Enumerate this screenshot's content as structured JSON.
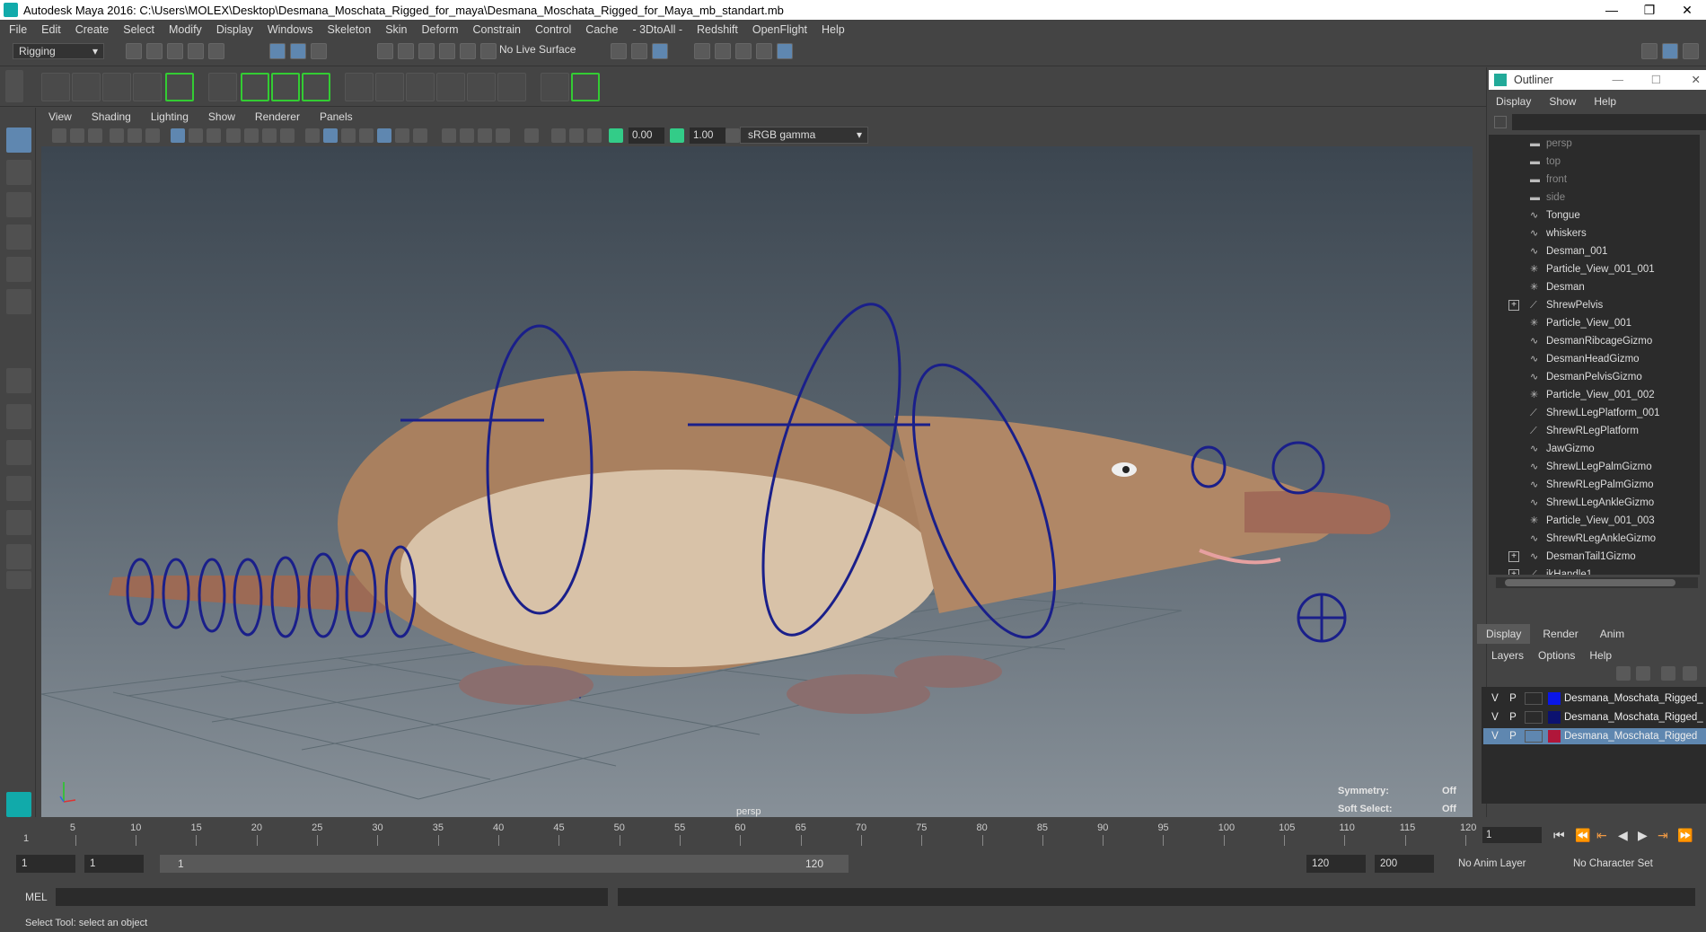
{
  "window": {
    "title": "Autodesk Maya 2016: C:\\Users\\MOLEX\\Desktop\\Desmana_Moschata_Rigged_for_maya\\Desmana_Moschata_Rigged_for_Maya_mb_standart.mb",
    "minimize": "—",
    "maximize": "❐",
    "close": "✕"
  },
  "menubar": [
    "File",
    "Edit",
    "Create",
    "Select",
    "Modify",
    "Display",
    "Windows",
    "Skeleton",
    "Skin",
    "Deform",
    "Constrain",
    "Control",
    "Cache",
    "- 3DtoAll -",
    "Redshift",
    "OpenFlight",
    "Help"
  ],
  "statusline": {
    "mode": "Rigging",
    "live_surface": "No Live Surface"
  },
  "panel": {
    "menus": [
      "View",
      "Shading",
      "Lighting",
      "Show",
      "Renderer",
      "Panels"
    ],
    "field_a": "0.00",
    "field_b": "1.00",
    "color_mgmt": "sRGB gamma",
    "camera_label": "persp",
    "symmetry_label": "Symmetry:",
    "symmetry_value": "Off",
    "softselect_label": "Soft Select:",
    "softselect_value": "Off"
  },
  "outliner": {
    "title": "Outliner",
    "menus": [
      "Display",
      "Show",
      "Help"
    ],
    "items": [
      {
        "name": "persp",
        "icon": "camera-icon",
        "dim": true,
        "expander": false
      },
      {
        "name": "top",
        "icon": "camera-icon",
        "dim": true,
        "expander": false
      },
      {
        "name": "front",
        "icon": "camera-icon",
        "dim": true,
        "expander": false
      },
      {
        "name": "side",
        "icon": "camera-icon",
        "dim": true,
        "expander": false
      },
      {
        "name": "Tongue",
        "icon": "curve-icon",
        "dim": false,
        "expander": false
      },
      {
        "name": "whiskers",
        "icon": "curve-icon",
        "dim": false,
        "expander": false
      },
      {
        "name": "Desman_001",
        "icon": "curve-icon",
        "dim": false,
        "expander": false
      },
      {
        "name": "Particle_View_001_001",
        "icon": "particle-icon",
        "dim": false,
        "expander": false
      },
      {
        "name": "Desman",
        "icon": "particle-icon",
        "dim": false,
        "expander": false
      },
      {
        "name": "ShrewPelvis",
        "icon": "joint-icon",
        "dim": false,
        "expander": true
      },
      {
        "name": "Particle_View_001",
        "icon": "particle-icon",
        "dim": false,
        "expander": false
      },
      {
        "name": "DesmanRibcageGizmo",
        "icon": "curve-icon",
        "dim": false,
        "expander": false
      },
      {
        "name": "DesmanHeadGizmo",
        "icon": "curve-icon",
        "dim": false,
        "expander": false
      },
      {
        "name": "DesmanPelvisGizmo",
        "icon": "curve-icon",
        "dim": false,
        "expander": false
      },
      {
        "name": "Particle_View_001_002",
        "icon": "particle-icon",
        "dim": false,
        "expander": false
      },
      {
        "name": "ShrewLLegPlatform_001",
        "icon": "joint-icon",
        "dim": false,
        "expander": false
      },
      {
        "name": "ShrewRLegPlatform",
        "icon": "joint-icon",
        "dim": false,
        "expander": false
      },
      {
        "name": "JawGizmo",
        "icon": "curve-icon",
        "dim": false,
        "expander": false
      },
      {
        "name": "ShrewLLegPalmGizmo",
        "icon": "curve-icon",
        "dim": false,
        "expander": false
      },
      {
        "name": "ShrewRLegPalmGizmo",
        "icon": "curve-icon",
        "dim": false,
        "expander": false
      },
      {
        "name": "ShrewLLegAnkleGizmo",
        "icon": "curve-icon",
        "dim": false,
        "expander": false
      },
      {
        "name": "Particle_View_001_003",
        "icon": "particle-icon",
        "dim": false,
        "expander": false
      },
      {
        "name": "ShrewRLegAnkleGizmo",
        "icon": "curve-icon",
        "dim": false,
        "expander": false
      },
      {
        "name": "DesmanTail1Gizmo",
        "icon": "curve-icon",
        "dim": false,
        "expander": true
      },
      {
        "name": "ikHandle1",
        "icon": "joint-icon",
        "dim": false,
        "expander": true
      }
    ]
  },
  "channelbox": {
    "tabs": [
      "Display",
      "Render",
      "Anim"
    ],
    "menus": [
      "Layers",
      "Options",
      "Help"
    ],
    "layers": [
      {
        "v": "V",
        "p": "P",
        "color": "#0a16e8",
        "name": "Desmana_Moschata_Rigged_",
        "selected": false
      },
      {
        "v": "V",
        "p": "P",
        "color": "#0c1270",
        "name": "Desmana_Moschata_Rigged_",
        "selected": false
      },
      {
        "v": "V",
        "p": "P",
        "color": "#b0163a",
        "name": "Desmana_Moschata_Rigged",
        "selected": true
      }
    ]
  },
  "timeline": {
    "ticks": [
      "5",
      "10",
      "15",
      "20",
      "25",
      "30",
      "35",
      "40",
      "45",
      "50",
      "55",
      "60",
      "65",
      "70",
      "75",
      "80",
      "85",
      "90",
      "95",
      "100",
      "105",
      "110",
      "115",
      "120"
    ],
    "start_tick": "1",
    "current_frame": "1"
  },
  "range": {
    "start": "1",
    "playback_start": "1",
    "slider_start": "1",
    "slider_end": "120",
    "playback_end": "120",
    "end": "200",
    "anim_layer": "No Anim Layer",
    "character_set": "No Character Set"
  },
  "cmdline": {
    "label": "MEL"
  },
  "helpline": {
    "text": "Select Tool: select an object"
  },
  "colors": {
    "accent": "#5f87b0",
    "rig_controls": "#1a1f8a"
  }
}
